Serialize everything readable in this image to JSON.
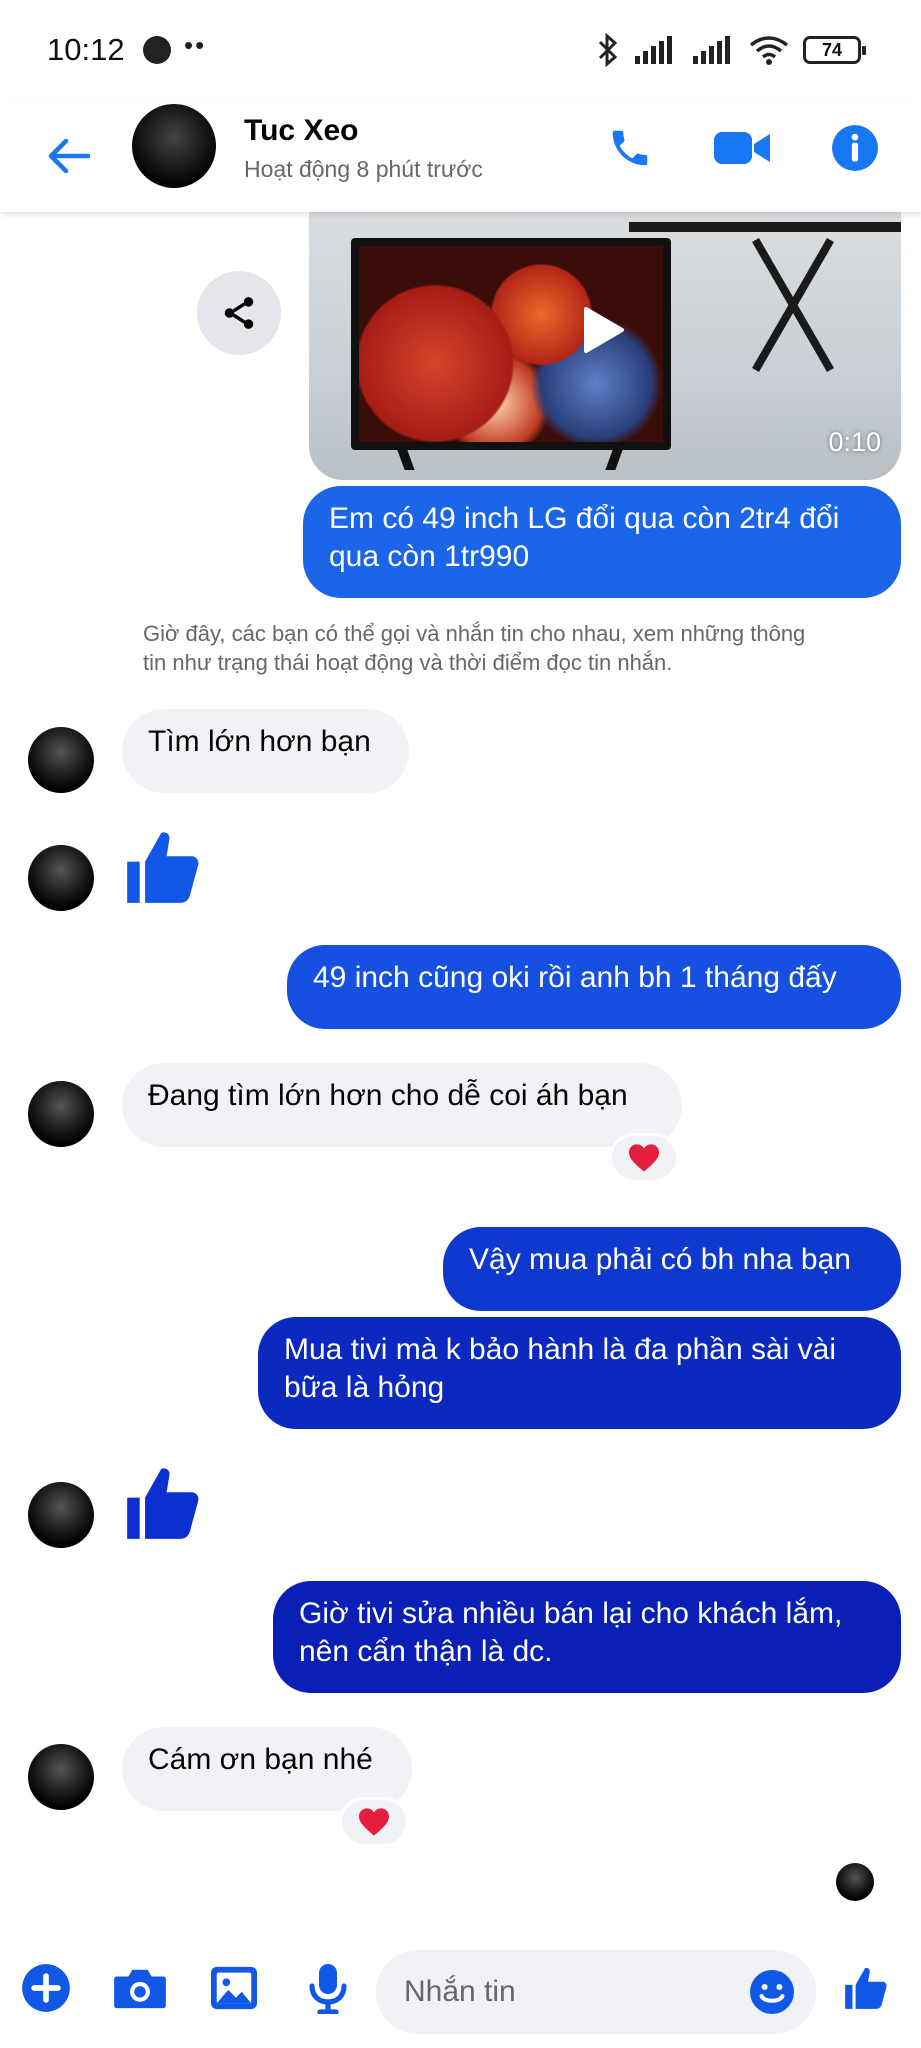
{
  "status_bar": {
    "time": "10:12",
    "dots": "••",
    "battery": "74"
  },
  "header": {
    "name": "Tuc Xeo",
    "activity": "Hoạt động 8 phút trước"
  },
  "colors": {
    "accent": "#1877f2",
    "bubble_top": "#1b64e6",
    "bubble_bottom": "#0a1fb5",
    "incoming": "#f0f2f5",
    "heart": "#e41e3f"
  },
  "video": {
    "duration": "0:10"
  },
  "messages": {
    "m1": "Em có 49 inch LG đổi qua còn 2tr4 đổi qua còn 1tr990",
    "system_note": "Giờ đây, các bạn có thể gọi và nhắn tin cho nhau, xem những thông tin như trạng thái hoạt động và thời điểm đọc tin nhắn.",
    "m2": "Tìm lớn hơn bạn",
    "m3": "49 inch cũng oki rồi anh bh 1 tháng đấy",
    "m4": "Đang tìm lớn hơn cho dễ coi áh bạn",
    "m5": "Vậy mua phải có bh nha bạn",
    "m6": "Mua tivi mà k bảo hành là đa phần sài vài bữa là hỏng",
    "m7": "Giờ tivi sửa nhiều bán lại cho khách lắm, nên cẩn thận là dc.",
    "m8": "Cám ơn bạn nhé"
  },
  "composer": {
    "placeholder": "Nhắn tin"
  }
}
